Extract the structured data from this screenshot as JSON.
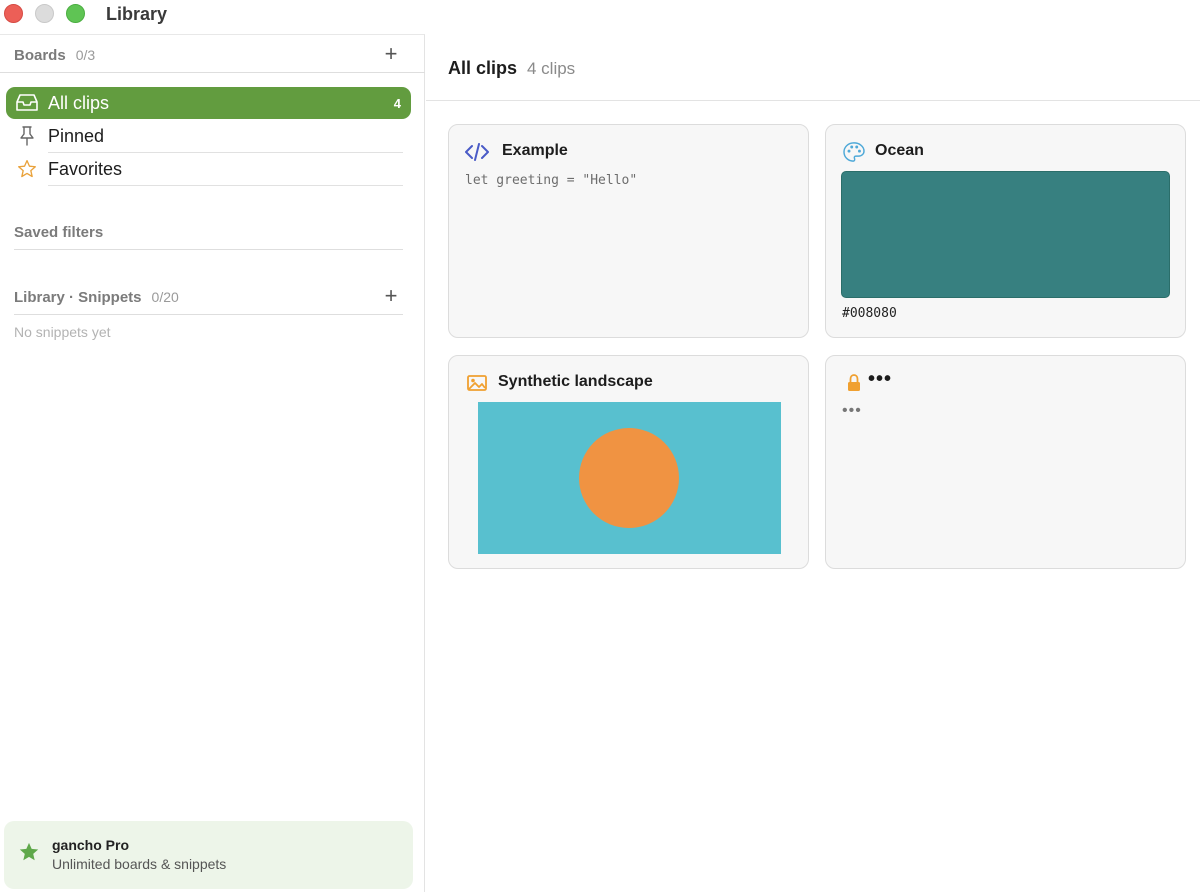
{
  "window": {
    "title": "Library"
  },
  "sidebar": {
    "boards": {
      "title": "Boards",
      "count": "0/3"
    },
    "items": [
      {
        "label": "All clips",
        "badge": "4",
        "icon": "inbox-icon",
        "active": true
      },
      {
        "label": "Pinned",
        "icon": "pin-icon"
      },
      {
        "label": "Favorites",
        "icon": "star-outline-icon"
      }
    ],
    "saved_filters": {
      "title": "Saved filters"
    },
    "snippets": {
      "title": "Library · Snippets",
      "count": "0/20",
      "empty": "No snippets yet"
    },
    "pro": {
      "title": "gancho Pro",
      "subtitle": "Unlimited boards & snippets"
    }
  },
  "main": {
    "title": "All clips",
    "count": "4 clips",
    "cards": [
      {
        "title": "Example",
        "type": "code",
        "content": "let greeting = \"Hello\"",
        "icon": "code-icon"
      },
      {
        "title": "Ocean",
        "type": "color",
        "hex": "#008080",
        "icon": "palette-icon"
      },
      {
        "title": "Synthetic landscape",
        "type": "image",
        "icon": "image-icon"
      },
      {
        "title": "•••",
        "type": "locked",
        "content": "•••",
        "icon": "lock-icon"
      }
    ]
  },
  "colors": {
    "accent": "#629c3f",
    "swatch": "#378080",
    "landscape_sky": "#58c0cf",
    "landscape_sun": "#f09342",
    "lock": "#f0a030",
    "code_icon": "#4a5bc7"
  }
}
